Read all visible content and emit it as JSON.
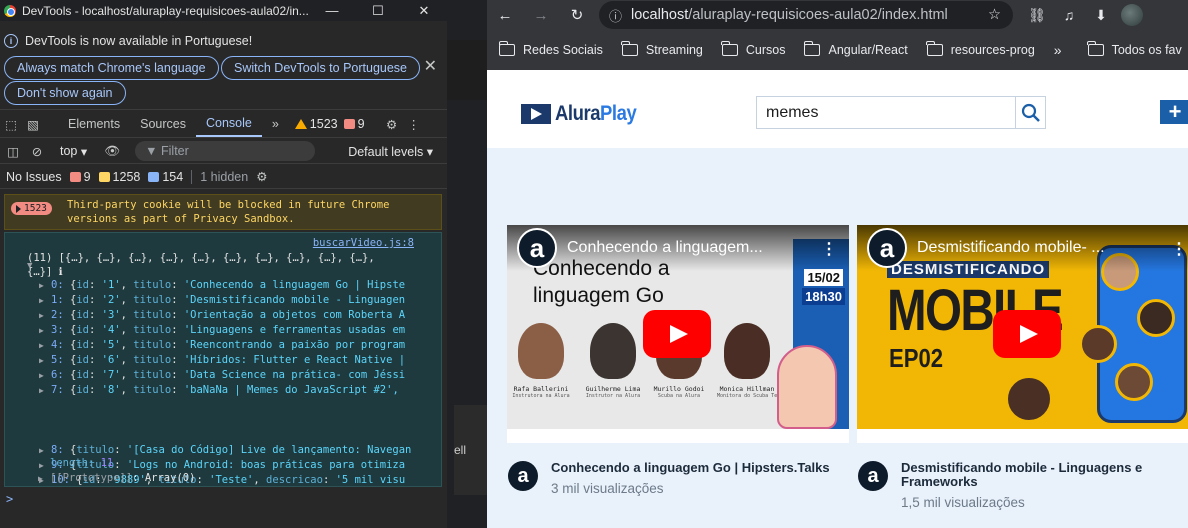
{
  "devtools": {
    "window_title": "DevTools - localhost/aluraplay-requisicoes-aula02/in...",
    "infobar": {
      "message": "DevTools is now available in Portuguese!",
      "btn_match": "Always match Chrome's language",
      "btn_switch": "Switch DevTools to Portuguese",
      "btn_dont_show": "Don't show again"
    },
    "tabs": [
      "Elements",
      "Sources",
      "Console"
    ],
    "active_tab": "Console",
    "warning_count": "1523",
    "error_count": "9",
    "toolbar": {
      "context": "top",
      "filter_placeholder": "Filter",
      "levels": "Default levels"
    },
    "issues": {
      "label": "No Issues",
      "errors": "9",
      "warnings": "1258",
      "info": "154",
      "hidden": "1 hidden"
    },
    "console": {
      "cookie_badge": "1523",
      "cookie_message_1": "Third-party cookie will be blocked in future Chrome",
      "cookie_message_2": "versions as part of Privacy Sandbox.",
      "source_link": "buscarVideo.js:8",
      "array_header_1": "(11) [{…}, {…}, {…}, {…}, {…}, {…}, {…}, {…}, {…}, {…},",
      "array_header_2": "{…}] ℹ",
      "rows": [
        {
          "idx": "0:",
          "id": "'1'",
          "titulo": "'Conhecendo a linguagem Go | Hipste"
        },
        {
          "idx": "1:",
          "id": "'2'",
          "titulo": "'Desmistificando mobile - Linguagen"
        },
        {
          "idx": "2:",
          "id": "'3'",
          "titulo": "'Orientação a objetos com Roberta A"
        },
        {
          "idx": "3:",
          "id": "'4'",
          "titulo": "'Linguagens e ferramentas usadas em"
        },
        {
          "idx": "4:",
          "id": "'5'",
          "titulo": "'Reencontrando a paixão por program"
        },
        {
          "idx": "5:",
          "id": "'6'",
          "titulo": "'Híbridos: Flutter e React Native |"
        },
        {
          "idx": "6:",
          "id": "'7'",
          "titulo": "'Data Science na prática- com Jéssi"
        },
        {
          "idx": "7:",
          "id": "'8'",
          "titulo": "'baNaNa | Memes do JavaScript #2', "
        }
      ],
      "row8": {
        "idx": "8:",
        "titulo": "'[Casa do Código] Live de lançamento: Navegan"
      },
      "row9": {
        "idx": "9:",
        "titulo": "'Logs no Android: boas práticas para otimiza"
      },
      "row10": {
        "idx": "10:",
        "id": "'9889'",
        "titulo": "'Teste'",
        "descricao": "'5 mil visu"
      },
      "length_label": "length:",
      "length_value": "11",
      "prototype_label": "[[Prototype]]",
      "prototype_value": "Array(0)",
      "prompt": ">"
    },
    "gap_fragment": "ell"
  },
  "browser": {
    "url_host": "localhost",
    "url_path": "/aluraplay-requisicoes-aula02/index.html",
    "bookmarks": [
      "Redes Sociais",
      "Streaming",
      "Cursos",
      "Angular/React",
      "resources-prog"
    ],
    "bookmarks_more": "»",
    "bookmarks_all": "Todos os fav",
    "site": {
      "logo_a": "Alura",
      "logo_b": "Play",
      "search_value": "memes",
      "add_label": "+",
      "videos": [
        {
          "overlay_title": "Conhecendo a linguagem...",
          "thumb_heading_1": "Conhecendo a",
          "thumb_heading_2": "linguagem Go",
          "date": "15/02",
          "time": "18h30",
          "people": [
            {
              "name": "Rafa Ballerini",
              "role": "Instrutora na Alura"
            },
            {
              "name": "Guilherme Lima",
              "role": "Instrutor na Alura"
            },
            {
              "name": "Murillo Godoi",
              "role": "Scuba na Alura"
            },
            {
              "name": "Monica Hillman",
              "role": "Monitora do Scuba Team e Alura Star"
            }
          ],
          "title": "Conhecendo a linguagem Go | Hipsters.Talks",
          "views": "3 mil visualizações"
        },
        {
          "overlay_title": "Desmistificando mobile- ...",
          "thumb_heading": "DESMISTIFICANDO",
          "thumb_big": "MOBILE",
          "thumb_ep": "EP02",
          "title": "Desmistificando mobile - Linguagens e Frameworks",
          "views": "1,5 mil visualizações"
        }
      ]
    }
  },
  "colors": {
    "alura_dark": "#1b3a6b",
    "alura_blue": "#2a7ae2",
    "page_bg": "#e9f1fb",
    "yt_red": "#ff0000"
  }
}
